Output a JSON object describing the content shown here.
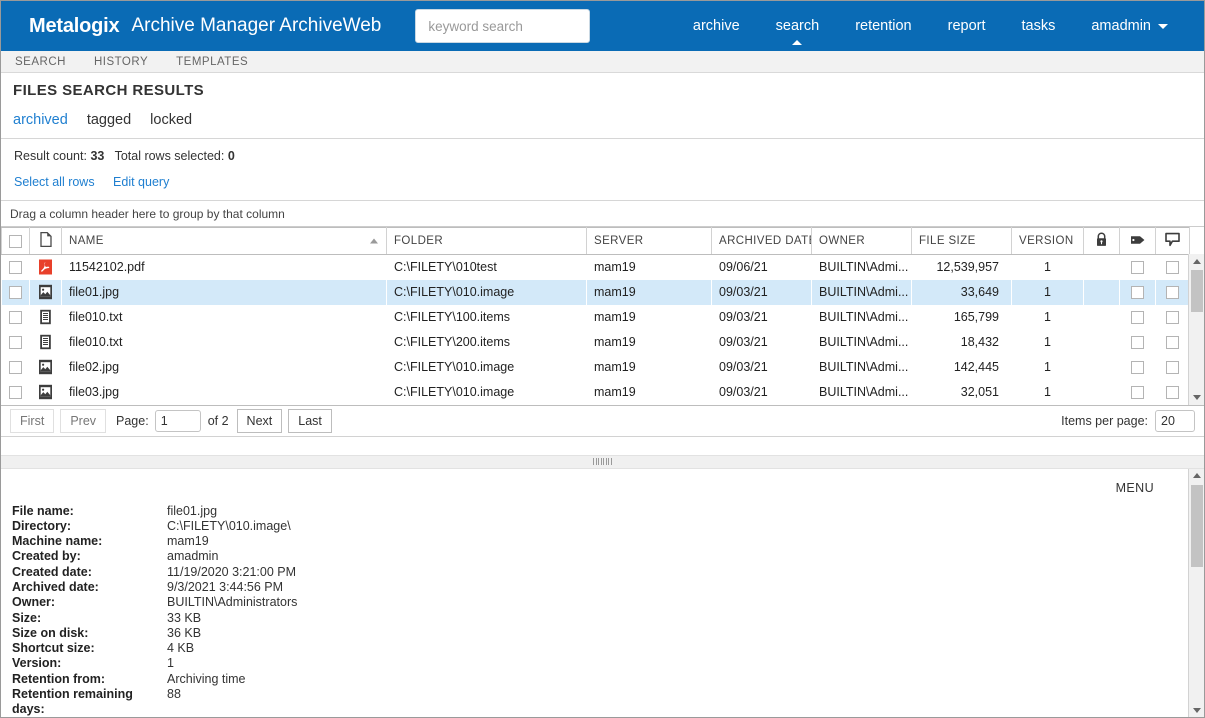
{
  "header": {
    "brand": "Metalogix",
    "app_title": "Archive Manager ArchiveWeb",
    "search_placeholder": "keyword search",
    "search_value": "",
    "nav": [
      {
        "label": "archive",
        "active": false
      },
      {
        "label": "search",
        "active": true
      },
      {
        "label": "retention",
        "active": false
      },
      {
        "label": "report",
        "active": false
      },
      {
        "label": "tasks",
        "active": false
      }
    ],
    "user": "amadmin",
    "brand_color": "#0a6bb5"
  },
  "subnav": {
    "tabs": [
      {
        "label": "SEARCH"
      },
      {
        "label": "HISTORY"
      },
      {
        "label": "TEMPLATES"
      }
    ]
  },
  "page": {
    "title": "FILES SEARCH RESULTS",
    "filters": [
      {
        "label": "archived",
        "selected": true
      },
      {
        "label": "tagged",
        "selected": false
      },
      {
        "label": "locked",
        "selected": false
      }
    ],
    "link_color": "#1f7fd0"
  },
  "results": {
    "result_count_label": "Result count:",
    "result_count": "33",
    "total_selected_label": "Total rows selected:",
    "total_selected": "0",
    "select_all_rows": "Select all rows",
    "edit_query": "Edit query",
    "group_hint": "Drag a column header here to group by that column"
  },
  "grid": {
    "columns": [
      {
        "label": "",
        "key": "check",
        "icon": "checkbox-icon"
      },
      {
        "label": "",
        "key": "type",
        "icon": "document-icon"
      },
      {
        "label": "NAME",
        "key": "name",
        "sorted": "asc"
      },
      {
        "label": "FOLDER",
        "key": "folder"
      },
      {
        "label": "SERVER",
        "key": "server"
      },
      {
        "label": "ARCHIVED DATE",
        "key": "archived_date"
      },
      {
        "label": "OWNER",
        "key": "owner"
      },
      {
        "label": "FILE SIZE",
        "key": "file_size"
      },
      {
        "label": "VERSION",
        "key": "version"
      },
      {
        "label": "",
        "key": "lock",
        "icon": "lock-icon"
      },
      {
        "label": "",
        "key": "tag",
        "icon": "tag-icon"
      },
      {
        "label": "",
        "key": "note",
        "icon": "comment-icon"
      }
    ],
    "rows": [
      {
        "icon": "pdf-icon",
        "name": "11542102.pdf",
        "folder": "C:\\FILETY\\010test",
        "server": "mam19",
        "archived_date": "09/06/21",
        "owner": "BUILTIN\\Admi...",
        "file_size": "12,539,957",
        "version": "1",
        "selected": false
      },
      {
        "icon": "image-icon",
        "name": "file01.jpg",
        "folder": "C:\\FILETY\\010.image",
        "server": "mam19",
        "archived_date": "09/03/21",
        "owner": "BUILTIN\\Admi...",
        "file_size": "33,649",
        "version": "1",
        "selected": true
      },
      {
        "icon": "text-icon",
        "name": "file010.txt",
        "folder": "C:\\FILETY\\100.items",
        "server": "mam19",
        "archived_date": "09/03/21",
        "owner": "BUILTIN\\Admi...",
        "file_size": "165,799",
        "version": "1",
        "selected": false
      },
      {
        "icon": "text-icon",
        "name": "file010.txt",
        "folder": "C:\\FILETY\\200.items",
        "server": "mam19",
        "archived_date": "09/03/21",
        "owner": "BUILTIN\\Admi...",
        "file_size": "18,432",
        "version": "1",
        "selected": false
      },
      {
        "icon": "image-icon",
        "name": "file02.jpg",
        "folder": "C:\\FILETY\\010.image",
        "server": "mam19",
        "archived_date": "09/03/21",
        "owner": "BUILTIN\\Admi...",
        "file_size": "142,445",
        "version": "1",
        "selected": false
      },
      {
        "icon": "image-icon",
        "name": "file03.jpg",
        "folder": "C:\\FILETY\\010.image",
        "server": "mam19",
        "archived_date": "09/03/21",
        "owner": "BUILTIN\\Admi...",
        "file_size": "32,051",
        "version": "1",
        "selected": false
      }
    ]
  },
  "pager": {
    "first": "First",
    "prev": "Prev",
    "page_label": "Page:",
    "page_value": "1",
    "of_label": "of 2",
    "next": "Next",
    "last": "Last",
    "items_per_page_label": "Items per page:",
    "items_per_page_value": "20"
  },
  "detail": {
    "menu_label": "MENU",
    "fields": [
      {
        "label": "File name:",
        "value": "file01.jpg"
      },
      {
        "label": "Directory:",
        "value": "C:\\FILETY\\010.image\\"
      },
      {
        "label": "Machine name:",
        "value": "mam19"
      },
      {
        "label": "Created by:",
        "value": "amadmin"
      },
      {
        "label": "Created date:",
        "value": "11/19/2020 3:21:00 PM"
      },
      {
        "label": "Archived date:",
        "value": "9/3/2021 3:44:56 PM"
      },
      {
        "label": "Owner:",
        "value": "BUILTIN\\Administrators"
      },
      {
        "label": "Size:",
        "value": "33 KB"
      },
      {
        "label": "Size on disk:",
        "value": "36 KB"
      },
      {
        "label": "Shortcut size:",
        "value": "4 KB"
      },
      {
        "label": "Version:",
        "value": "1"
      },
      {
        "label": "Retention from:",
        "value": "Archiving time"
      },
      {
        "label": "Retention remaining days:",
        "value": "88"
      }
    ]
  }
}
